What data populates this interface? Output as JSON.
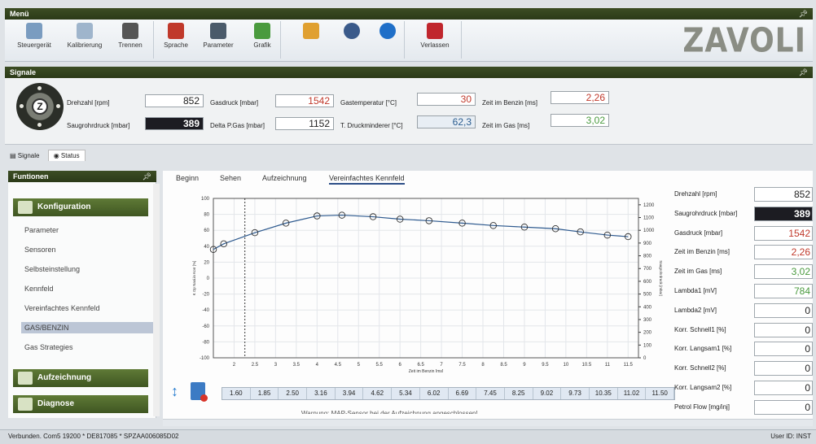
{
  "menu": {
    "title": "Menü",
    "pin": "†"
  },
  "ribbon": {
    "buttons": [
      {
        "label": "Steuergerät",
        "icon": "ecu-icon",
        "color": "#7a9cc0"
      },
      {
        "label": "Kalibrierung",
        "icon": "calibration-icon",
        "color": "#9fb5cc"
      },
      {
        "label": "Trennen",
        "icon": "disconnect-icon",
        "color": "#555555"
      },
      {
        "label": "Sprache",
        "icon": "language-icon",
        "color": "#c0392b"
      },
      {
        "label": "Parameter",
        "icon": "wrench-icon",
        "color": "#4a5a6a"
      },
      {
        "label": "Grafik",
        "icon": "chart-icon",
        "color": "#4a9a3e"
      },
      {
        "label": "",
        "icon": "book-icon",
        "color": "#e0a030"
      },
      {
        "label": "",
        "icon": "user-icon",
        "color": "#3a5a8a"
      },
      {
        "label": "",
        "icon": "info-icon",
        "color": "#1f6fc8"
      },
      {
        "label": "Verlassen",
        "icon": "power-icon",
        "color": "#c0262d"
      }
    ],
    "logo": "ZAVOLI"
  },
  "signale": {
    "title": "Signale",
    "fields": [
      {
        "label": "Drehzahl [rpm]",
        "value": "852",
        "style": ""
      },
      {
        "label": "Saugrohrdruck [mbar]",
        "value": "389",
        "style": "dark"
      },
      {
        "label": "Gasdruck [mbar]",
        "value": "1542",
        "style": "red"
      },
      {
        "label": "Delta P.Gas [mbar]",
        "value": "1152",
        "style": ""
      },
      {
        "label": "Gastemperatur [°C]",
        "value": "30",
        "style": "red"
      },
      {
        "label": "T. Druckminderer [°C]",
        "value": "62,3",
        "style": "blue"
      },
      {
        "label": "Zeit im Benzin [ms]",
        "value": "2,26",
        "style": "red"
      },
      {
        "label": "Zeit im Gas [ms]",
        "value": "3,02",
        "style": "green"
      }
    ],
    "gauge_letter": "Z"
  },
  "signal_tabs": [
    {
      "label": "Signale"
    },
    {
      "label": "Status"
    }
  ],
  "funktionen": {
    "title": "Funtionen",
    "groups": [
      {
        "label": "Konfiguration"
      },
      {
        "label": "Aufzeichnung"
      },
      {
        "label": "Diagnose"
      }
    ],
    "items": [
      "Parameter",
      "Sensoren",
      "Selbsteinstellung",
      "Kennfeld",
      "Vereinfachtes Kennfeld",
      "GAS/BENZIN",
      "Gas Strategies"
    ],
    "selected": "GAS/BENZIN"
  },
  "main_tabs": [
    "Beginn",
    "Sehen",
    "Aufzeichnung",
    "Vereinfachtes Kennfeld"
  ],
  "chart_data": {
    "type": "line",
    "xlabel": "Zeit im Benzin [ms]",
    "ylabel_left": "K Op Nasi.in Korr [%]",
    "ylabel_right": "Saugrohrdruck [mbar]",
    "xlim": [
      1.5,
      11.75
    ],
    "ylim": [
      -100,
      100
    ],
    "y2lim": [
      0,
      1250
    ],
    "xticks": [
      2,
      2.5,
      3,
      3.5,
      4,
      4.5,
      5,
      5.5,
      6,
      6.5,
      7,
      7.5,
      8,
      8.5,
      9,
      9.5,
      10,
      10.5,
      11,
      11.5
    ],
    "yticks": [
      -100,
      -80,
      -60,
      -40,
      -20,
      0,
      20,
      40,
      60,
      80,
      100
    ],
    "y2ticks": [
      0,
      100,
      200,
      300,
      400,
      500,
      600,
      700,
      800,
      900,
      1000,
      1100,
      1200
    ],
    "marker_x": 2.26,
    "series": [
      {
        "x": [
          1.5,
          1.75,
          2.5,
          3.25,
          4.0,
          4.6,
          5.35,
          6.0,
          6.7,
          7.5,
          8.25,
          9.0,
          9.75,
          10.35,
          11.0,
          11.5
        ],
        "values": [
          36,
          43,
          57,
          69,
          78,
          79,
          77,
          74,
          72,
          69,
          66,
          64,
          62,
          58,
          54,
          52
        ]
      }
    ]
  },
  "breakpoints": [
    "1.60",
    "1.85",
    "2.50",
    "3.16",
    "3.94",
    "4.62",
    "5.34",
    "6.02",
    "6.69",
    "7.45",
    "8.25",
    "9.02",
    "9.73",
    "10.35",
    "11.02",
    "11.50"
  ],
  "warning_text": "Warnung: MAP-Sensor bei der Aufzeichnung angeschlossen!",
  "right_values": [
    {
      "label": "Drehzahl [rpm]",
      "value": "852",
      "style": ""
    },
    {
      "label": "Saugrohrdruck [mbar]",
      "value": "389",
      "style": "dark"
    },
    {
      "label": "Gasdruck [mbar]",
      "value": "1542",
      "style": "red"
    },
    {
      "label": "Zeit im Benzin [ms]",
      "value": "2,26",
      "style": "red"
    },
    {
      "label": "Zeit im Gas [ms]",
      "value": "3,02",
      "style": "green"
    },
    {
      "label": "Lambda1 [mV]",
      "value": "784",
      "style": "green"
    },
    {
      "label": "Lambda2 [mV]",
      "value": "0",
      "style": ""
    },
    {
      "label": "Korr. Schnell1 [%]",
      "value": "0",
      "style": ""
    },
    {
      "label": "Korr. Langsam1 [%]",
      "value": "0",
      "style": ""
    },
    {
      "label": "Korr. Schnell2 [%]",
      "value": "0",
      "style": ""
    },
    {
      "label": "Korr. Langsam2 [%]",
      "value": "0",
      "style": ""
    },
    {
      "label": "Petrol Flow [mg/inj]",
      "value": "0",
      "style": ""
    }
  ],
  "status": {
    "left": "Verbunden. Com5 19200 * DE817085 * SPZAA006085D02",
    "right": "User ID: INST"
  },
  "colors": {
    "header": "#2b3a18",
    "series": "#2e5a8f",
    "selected_row": "#bcc6d6"
  }
}
